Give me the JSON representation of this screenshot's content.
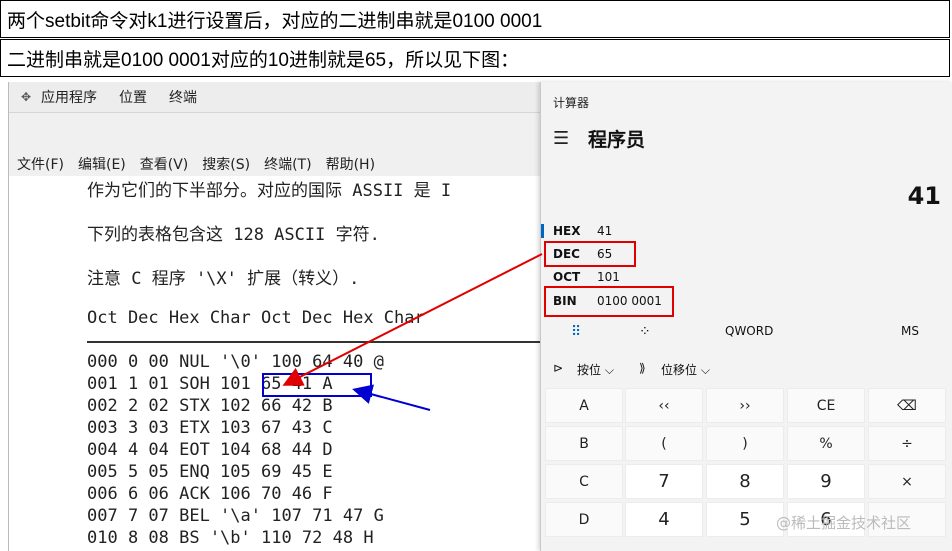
{
  "captions": {
    "line1": "两个setbit命令对k1进行设置后，对应的二进制串就是0100 0001",
    "line2": "二进制串就是0100 0001对应的10进制就是65，所以见下图："
  },
  "terminal": {
    "topbar": {
      "icon": "app-menu-icon",
      "items": [
        "应用程序",
        "位置",
        "终端"
      ]
    },
    "menubar": [
      "文件(F)",
      "编辑(E)",
      "查看(V)",
      "搜索(S)",
      "终端(T)",
      "帮助(H)"
    ],
    "lines": [
      "作为它们的下半部分。对应的国际 ASSII 是 I",
      "下列的表格包含这 128 ASCII 字符.",
      "注意 C 程序 '\\X' 扩展（转义）.",
      "Oct Dec Hex Char Oct Dec Hex Char",
      "000 0 00 NUL '\\0' 100 64 40 @",
      "001 1 01 SOH 101 65 41 A",
      "002 2 02 STX 102 66 42 B",
      "003 3 03 ETX 103 67 43 C",
      "004 4 04 EOT 104 68 44 D",
      "005 5 05 ENQ 105 69 45 E",
      "006 6 06 ACK 106 70 46 F",
      "007 7 07 BEL '\\a' 107 71 47 G",
      "010 8 08 BS '\\b' 110 72 48 H"
    ]
  },
  "calculator": {
    "title": "计算器",
    "mode": "程序员",
    "display": "41",
    "radix": [
      {
        "name": "HEX",
        "value": "41"
      },
      {
        "name": "DEC",
        "value": "65"
      },
      {
        "name": "OCT",
        "value": "101"
      },
      {
        "name": "BIN",
        "value": "0100 0001"
      }
    ],
    "tabs": {
      "keypad": "full-keypad-icon",
      "bitflip": "bit-toggle-icon",
      "word": "QWORD",
      "ms": "MS"
    },
    "ops": {
      "bitwise": "按位 ⌵",
      "shift": "位移位 ⌵"
    },
    "keys": [
      [
        "A",
        "‹‹",
        "››",
        "CE",
        "⌫"
      ],
      [
        "B",
        "(",
        ")",
        "%",
        "÷"
      ],
      [
        "C",
        "7",
        "8",
        "9",
        "×"
      ],
      [
        "D",
        "4",
        "5",
        "6",
        ""
      ]
    ]
  },
  "watermark": "@稀土掘金技术社区",
  "colors": {
    "annotation_red": "#e00000",
    "annotation_blue": "#0000d0",
    "calc_accent": "#0067c0"
  }
}
